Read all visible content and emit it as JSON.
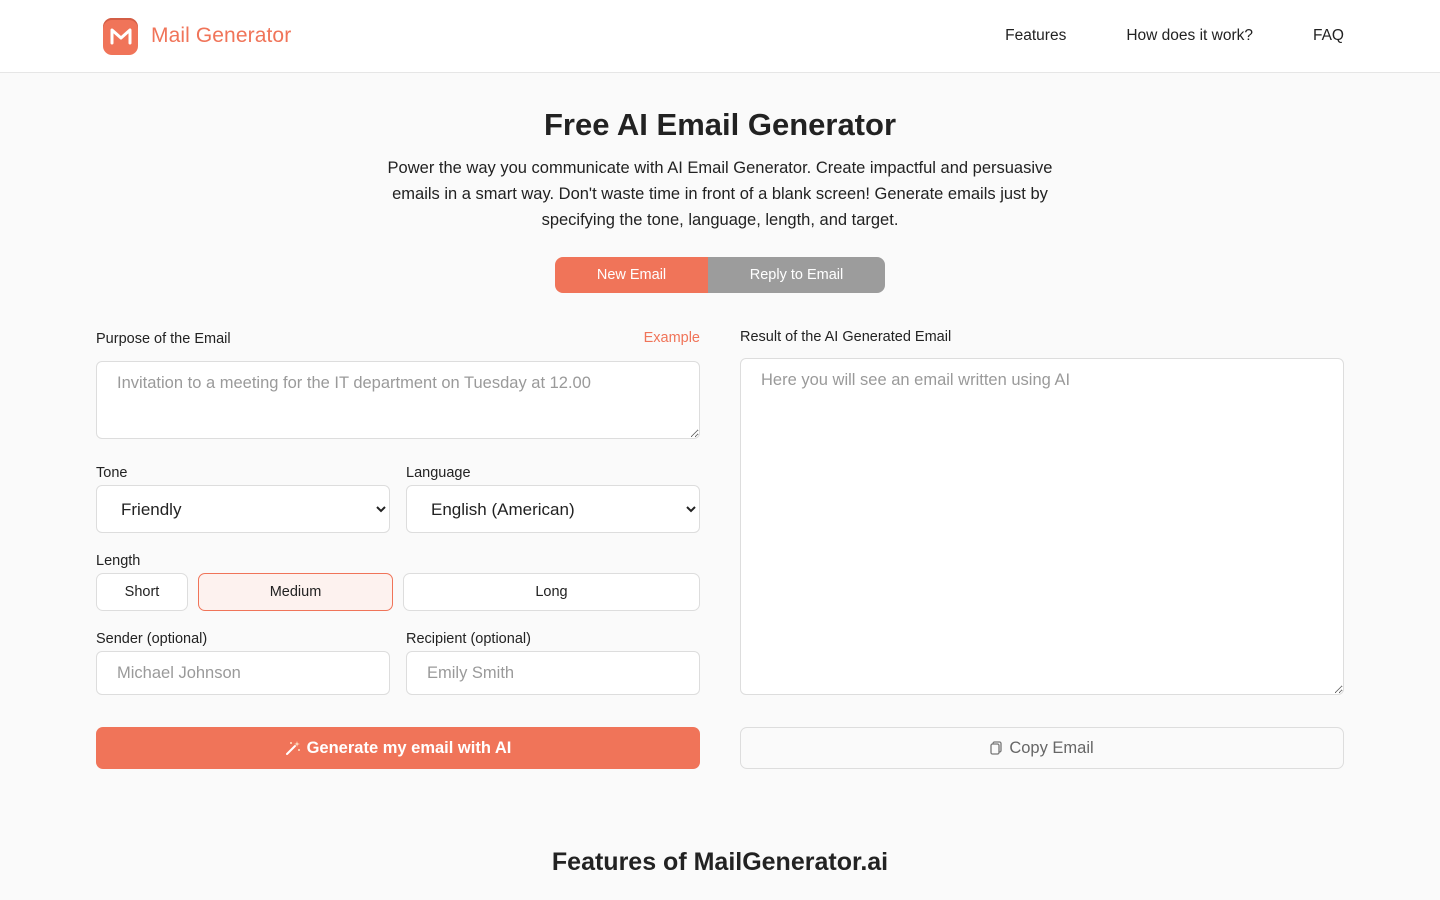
{
  "header": {
    "logo_text": "Mail Generator",
    "nav": {
      "features": "Features",
      "how": "How does it work?",
      "faq": "FAQ"
    }
  },
  "hero": {
    "title": "Free AI Email Generator",
    "description": "Power the way you communicate with AI Email Generator. Create impactful and persuasive emails in a smart way. Don't waste time in front of a blank screen! Generate emails just by specifying the tone, language, length, and target.",
    "tabs": {
      "new": "New Email",
      "reply": "Reply to Email",
      "active": "new"
    }
  },
  "form": {
    "purpose_label": "Purpose of the Email",
    "example_link": "Example",
    "purpose_placeholder": "Invitation to a meeting for the IT department on Tuesday at 12.00",
    "purpose_value": "",
    "tone_label": "Tone",
    "tone_value": "Friendly",
    "language_label": "Language",
    "language_value": "English (American)",
    "length_label": "Length",
    "length_options": {
      "short": "Short",
      "medium": "Medium",
      "long": "Long",
      "selected": "medium"
    },
    "sender_label": "Sender (optional)",
    "sender_placeholder": "Michael Johnson",
    "recipient_label": "Recipient (optional)",
    "recipient_placeholder": "Emily Smith",
    "generate_button": "Generate my email with AI"
  },
  "result": {
    "label": "Result of the AI Generated Email",
    "placeholder": "Here you will see an email written using AI",
    "copy_button": "Copy Email"
  },
  "features": {
    "title": "Features of MailGenerator.ai"
  },
  "colors": {
    "accent": "#f07459",
    "tab_inactive": "#9c9c9c",
    "background": "#fafafa"
  },
  "icons": {
    "logo": "mail-m-logo-icon",
    "generate": "magic-wand-icon",
    "copy": "copy-icon"
  }
}
